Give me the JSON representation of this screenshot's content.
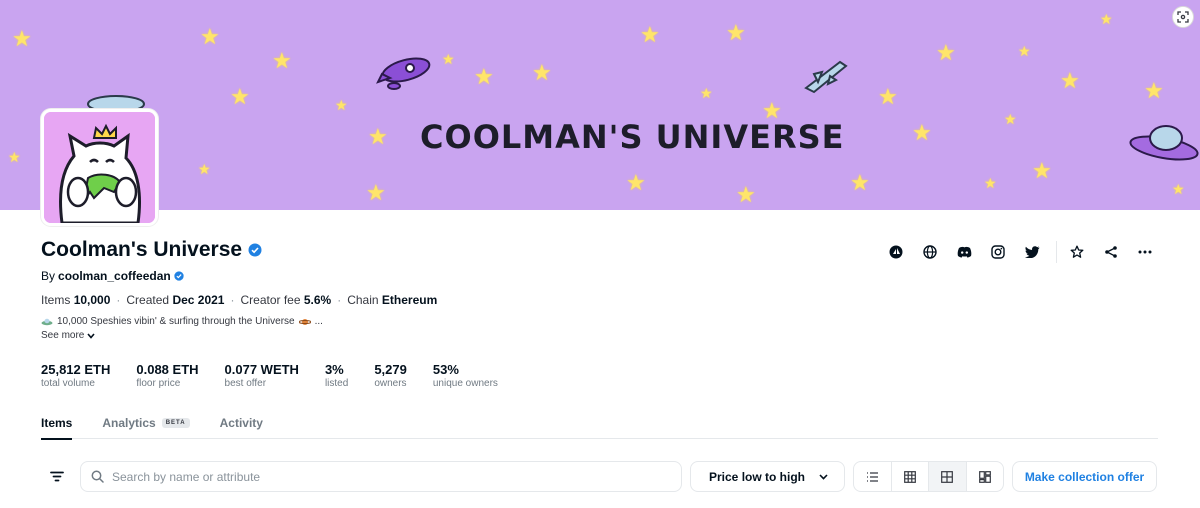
{
  "banner": {
    "title": "COOLMAN'S UNIVERSE"
  },
  "collection": {
    "name": "Coolman's Universe",
    "by_label": "By",
    "creator": "coolman_coffeedan",
    "items_label": "Items",
    "items_value": "10,000",
    "created_label": "Created",
    "created_value": "Dec 2021",
    "fee_label": "Creator fee",
    "fee_value": "5.6%",
    "chain_label": "Chain",
    "chain_value": "Ethereum",
    "description": "10,000 Speshies vibin' & surfing through the Universe",
    "ellipsis": "...",
    "see_more": "See more"
  },
  "stats": [
    {
      "value": "25,812 ETH",
      "label": "total volume"
    },
    {
      "value": "0.088 ETH",
      "label": "floor price"
    },
    {
      "value": "0.077 WETH",
      "label": "best offer"
    },
    {
      "value": "3%",
      "label": "listed"
    },
    {
      "value": "5,279",
      "label": "owners"
    },
    {
      "value": "53%",
      "label": "unique owners"
    }
  ],
  "tabs": [
    {
      "label": "Items",
      "active": true
    },
    {
      "label": "Analytics",
      "badge": "BETA"
    },
    {
      "label": "Activity"
    }
  ],
  "toolbar": {
    "search_placeholder": "Search by name or attribute",
    "sort_value": "Price low to high",
    "offer_button": "Make collection offer"
  },
  "icons": {
    "social": [
      "opensea-icon",
      "globe-icon",
      "discord-icon",
      "instagram-icon",
      "twitter-icon"
    ],
    "actions": [
      "star-icon",
      "share-icon",
      "more-icon"
    ],
    "views": [
      "list-view-icon",
      "grid-small-icon",
      "grid-large-icon",
      "grid-mixed-icon"
    ]
  },
  "colors": {
    "banner_bg": "#c9a4f0",
    "avatar_bg": "#e7a6f3",
    "accent_blue": "#2081e2",
    "verified_blue": "#2081e2",
    "star_yellow": "#ffe56a"
  }
}
